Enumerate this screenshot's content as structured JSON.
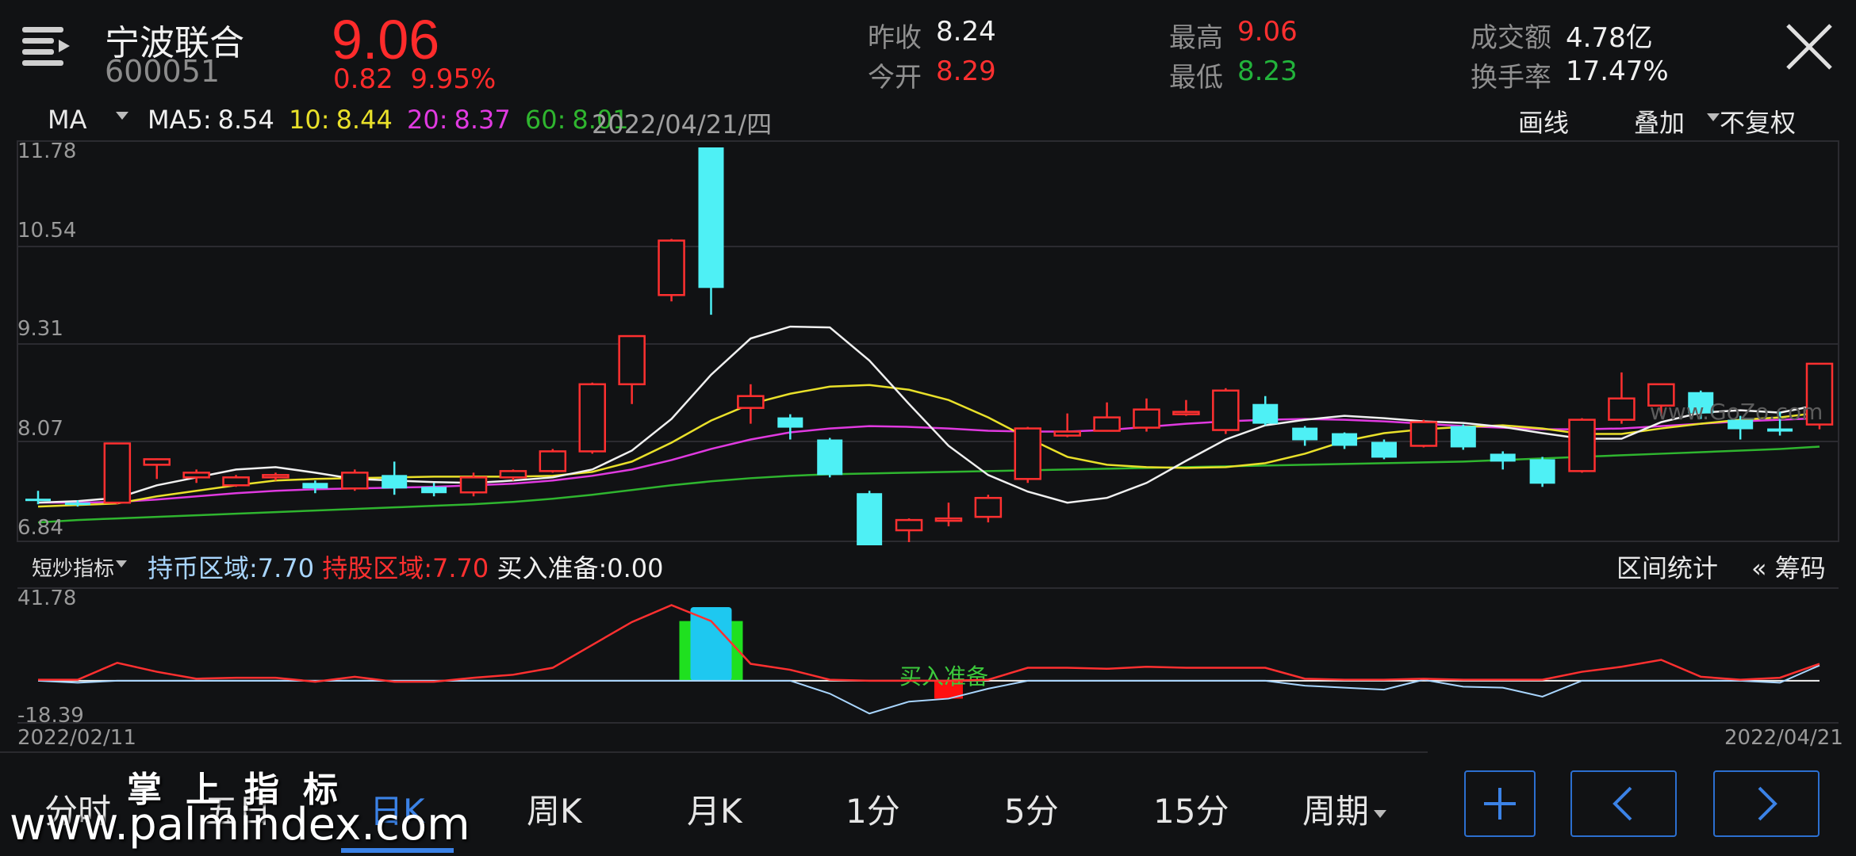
{
  "header": {
    "name": "宁波联合",
    "code": "600051",
    "price": "9.06",
    "change": "0.82",
    "change_pct": "9.95%",
    "stats": [
      {
        "label": "昨收",
        "value": "8.24",
        "color": "white"
      },
      {
        "label": "今开",
        "value": "8.29",
        "color": "red"
      },
      {
        "label": "最高",
        "value": "9.06",
        "color": "red"
      },
      {
        "label": "最低",
        "value": "8.23",
        "color": "green"
      },
      {
        "label": "成交额",
        "value": "4.78亿",
        "color": "white"
      },
      {
        "label": "换手率",
        "value": "17.47%",
        "color": "white"
      }
    ]
  },
  "ma_bar": {
    "select": "MA",
    "ma5_label": "MA5:",
    "ma5": "8.54",
    "ma10_label": "10:",
    "ma10": "8.44",
    "ma20_label": "20:",
    "ma20": "8.37",
    "ma60_label": "60:",
    "ma60": "8.01",
    "date": "2022/04/21/四",
    "draw": "画线",
    "overlay": "叠加",
    "adjust": "不复权"
  },
  "indicator_bar": {
    "select": "短炒指标",
    "coin_label": "持币区域:",
    "coin_value": "7.70",
    "stock_label": "持股区域:",
    "stock_value": "7.70",
    "buy_label": "买入准备:",
    "buy_value": "0.00",
    "range_stats": "区间统计",
    "chips": "筹码",
    "chips_arrow": "«"
  },
  "tabs": [
    {
      "label": "分时"
    },
    {
      "label": "五日"
    },
    {
      "label": "日K"
    },
    {
      "label": "周K"
    },
    {
      "label": "月K"
    },
    {
      "label": "1分"
    },
    {
      "label": "5分"
    },
    {
      "label": "15分"
    },
    {
      "label": "周期"
    }
  ],
  "watermark": {
    "line1": "掌上指标",
    "line2": "www.palmindex.com",
    "chart_mark": "www.GoZo.com"
  },
  "colors": {
    "up": "#ff3030",
    "down": "#4ef0f5",
    "ma5": "#f0f0f0",
    "ma10": "#e9e02a",
    "ma20": "#e03ae0",
    "ma60": "#2fb52f",
    "accent": "#3b82e6"
  },
  "chart_data": [
    {
      "type": "candlestick",
      "title": "",
      "ylim": [
        6.84,
        11.78
      ],
      "yticks": [
        "11.78",
        "10.54",
        "9.31",
        "8.07",
        "6.84"
      ],
      "ohlc": [
        [
          7.35,
          7.32,
          7.45,
          7.28
        ],
        [
          7.3,
          7.28,
          7.33,
          7.25
        ],
        [
          7.3,
          8.05,
          8.05,
          7.28
        ],
        [
          7.78,
          7.85,
          7.86,
          7.6
        ],
        [
          7.62,
          7.68,
          7.72,
          7.55
        ],
        [
          7.52,
          7.62,
          7.65,
          7.5
        ],
        [
          7.62,
          7.65,
          7.68,
          7.58
        ],
        [
          7.55,
          7.48,
          7.58,
          7.42
        ],
        [
          7.48,
          7.68,
          7.72,
          7.45
        ],
        [
          7.65,
          7.48,
          7.82,
          7.4
        ],
        [
          7.5,
          7.42,
          7.55,
          7.38
        ],
        [
          7.43,
          7.62,
          7.68,
          7.38
        ],
        [
          7.62,
          7.7,
          7.72,
          7.58
        ],
        [
          7.7,
          7.95,
          7.98,
          7.68
        ],
        [
          7.95,
          8.8,
          8.82,
          7.92
        ],
        [
          8.8,
          9.41,
          9.42,
          8.55
        ],
        [
          9.93,
          10.62,
          10.64,
          9.85
        ],
        [
          11.8,
          10.02,
          11.8,
          9.68
        ],
        [
          8.5,
          8.65,
          8.8,
          8.3
        ],
        [
          8.38,
          8.25,
          8.42,
          8.1
        ],
        [
          8.1,
          7.65,
          8.12,
          7.62
        ],
        [
          7.42,
          6.72,
          7.45,
          6.7
        ],
        [
          6.95,
          7.08,
          7.1,
          6.8
        ],
        [
          7.1,
          7.1,
          7.3,
          7.0
        ],
        [
          7.12,
          7.36,
          7.4,
          7.05
        ],
        [
          7.6,
          8.24,
          8.26,
          7.55
        ],
        [
          8.15,
          8.2,
          8.43,
          8.13
        ],
        [
          8.21,
          8.38,
          8.57,
          8.2
        ],
        [
          8.25,
          8.48,
          8.62,
          8.2
        ],
        [
          8.42,
          8.45,
          8.6,
          8.4
        ],
        [
          8.22,
          8.72,
          8.75,
          8.17
        ],
        [
          8.55,
          8.3,
          8.65,
          8.28
        ],
        [
          8.25,
          8.09,
          8.27,
          8.02
        ],
        [
          8.18,
          8.02,
          8.19,
          7.98
        ],
        [
          8.07,
          7.87,
          8.1,
          7.85
        ],
        [
          8.02,
          8.32,
          8.35,
          8.0
        ],
        [
          8.27,
          8.0,
          8.29,
          7.97
        ],
        [
          7.92,
          7.82,
          7.95,
          7.72
        ],
        [
          7.85,
          7.54,
          7.88,
          7.5
        ],
        [
          7.7,
          8.35,
          8.37,
          7.68
        ],
        [
          8.35,
          8.62,
          8.95,
          8.3
        ],
        [
          8.53,
          8.8,
          8.8,
          8.4
        ],
        [
          8.7,
          8.43,
          8.72,
          8.36
        ],
        [
          8.35,
          8.23,
          8.4,
          8.1
        ],
        [
          8.24,
          8.2,
          8.45,
          8.15
        ],
        [
          8.29,
          9.06,
          9.06,
          8.23
        ]
      ],
      "ma5": [
        7.3,
        7.32,
        7.36,
        7.52,
        7.62,
        7.72,
        7.75,
        7.68,
        7.6,
        7.58,
        7.56,
        7.55,
        7.58,
        7.62,
        7.72,
        7.96,
        8.36,
        8.92,
        9.38,
        9.53,
        9.52,
        9.1,
        8.55,
        8.02,
        7.65,
        7.44,
        7.3,
        7.36,
        7.55,
        7.83,
        8.1,
        8.28,
        8.35,
        8.4,
        8.37,
        8.33,
        8.31,
        8.26,
        8.18,
        8.11,
        8.11,
        8.32,
        8.44,
        8.47,
        8.44,
        8.54
      ],
      "ma10": [
        7.25,
        7.27,
        7.29,
        7.38,
        7.45,
        7.52,
        7.58,
        7.6,
        7.61,
        7.62,
        7.63,
        7.63,
        7.63,
        7.64,
        7.69,
        7.82,
        8.06,
        8.34,
        8.55,
        8.68,
        8.77,
        8.79,
        8.73,
        8.6,
        8.38,
        8.12,
        7.88,
        7.78,
        7.75,
        7.74,
        7.75,
        7.8,
        7.92,
        8.08,
        8.18,
        8.23,
        8.26,
        8.28,
        8.24,
        8.17,
        8.17,
        8.24,
        8.3,
        8.35,
        8.38,
        8.44
      ],
      "ma20": [
        7.3,
        7.3,
        7.31,
        7.34,
        7.38,
        7.42,
        7.45,
        7.47,
        7.48,
        7.49,
        7.5,
        7.52,
        7.54,
        7.58,
        7.64,
        7.72,
        7.84,
        7.98,
        8.1,
        8.19,
        8.24,
        8.27,
        8.26,
        8.24,
        8.21,
        8.2,
        8.2,
        8.22,
        8.26,
        8.3,
        8.33,
        8.35,
        8.36,
        8.35,
        8.33,
        8.3,
        8.27,
        8.25,
        8.23,
        8.23,
        8.24,
        8.27,
        8.3,
        8.33,
        8.35,
        8.37
      ],
      "ma60": [
        7.05,
        7.08,
        7.1,
        7.12,
        7.14,
        7.16,
        7.18,
        7.2,
        7.22,
        7.24,
        7.26,
        7.28,
        7.31,
        7.35,
        7.4,
        7.46,
        7.52,
        7.57,
        7.61,
        7.64,
        7.66,
        7.67,
        7.68,
        7.69,
        7.7,
        7.71,
        7.72,
        7.73,
        7.74,
        7.75,
        7.76,
        7.77,
        7.78,
        7.79,
        7.8,
        7.81,
        7.82,
        7.84,
        7.86,
        7.88,
        7.9,
        7.92,
        7.94,
        7.96,
        7.98,
        8.01
      ]
    },
    {
      "type": "line",
      "title": "",
      "xlabel_left": "2022/02/11",
      "xlabel_right": "2022/04/21",
      "ylim": [
        -18.39,
        41.78
      ],
      "yticks": [
        "41.78",
        "-18.39"
      ],
      "hold_stock": [
        0.5,
        0.5,
        9.0,
        4.5,
        1.0,
        1.5,
        1.5,
        -0.5,
        2.0,
        -0.5,
        -0.5,
        1.5,
        3.0,
        6.5,
        18.0,
        29.5,
        38.0,
        30.0,
        8.5,
        5.5,
        0.5,
        0,
        0,
        0,
        0.5,
        6.5,
        6.5,
        6.0,
        7.0,
        6.5,
        6.5,
        6.5,
        1.0,
        0.5,
        0.5,
        1.0,
        0.5,
        0.5,
        0.5,
        4.5,
        7.0,
        10.5,
        2.0,
        0.5,
        1.5,
        8.5
      ],
      "hold_coin": [
        0,
        -1.0,
        0,
        0,
        0,
        0,
        0,
        0,
        0,
        0,
        0,
        0,
        0,
        0,
        0,
        0,
        0,
        0,
        0,
        0,
        -6.5,
        -16.5,
        -10.5,
        -9.0,
        -4.0,
        0,
        0,
        0,
        0,
        0,
        0,
        0,
        -2.5,
        -3.5,
        -4.5,
        0.5,
        -3.0,
        -3.5,
        -8.0,
        0,
        0,
        0,
        0,
        0,
        -1.0,
        7.7
      ],
      "buy_ready_bar_index": 17,
      "buy_signal_index": 23,
      "buy_signal_text": "买入准备"
    }
  ]
}
